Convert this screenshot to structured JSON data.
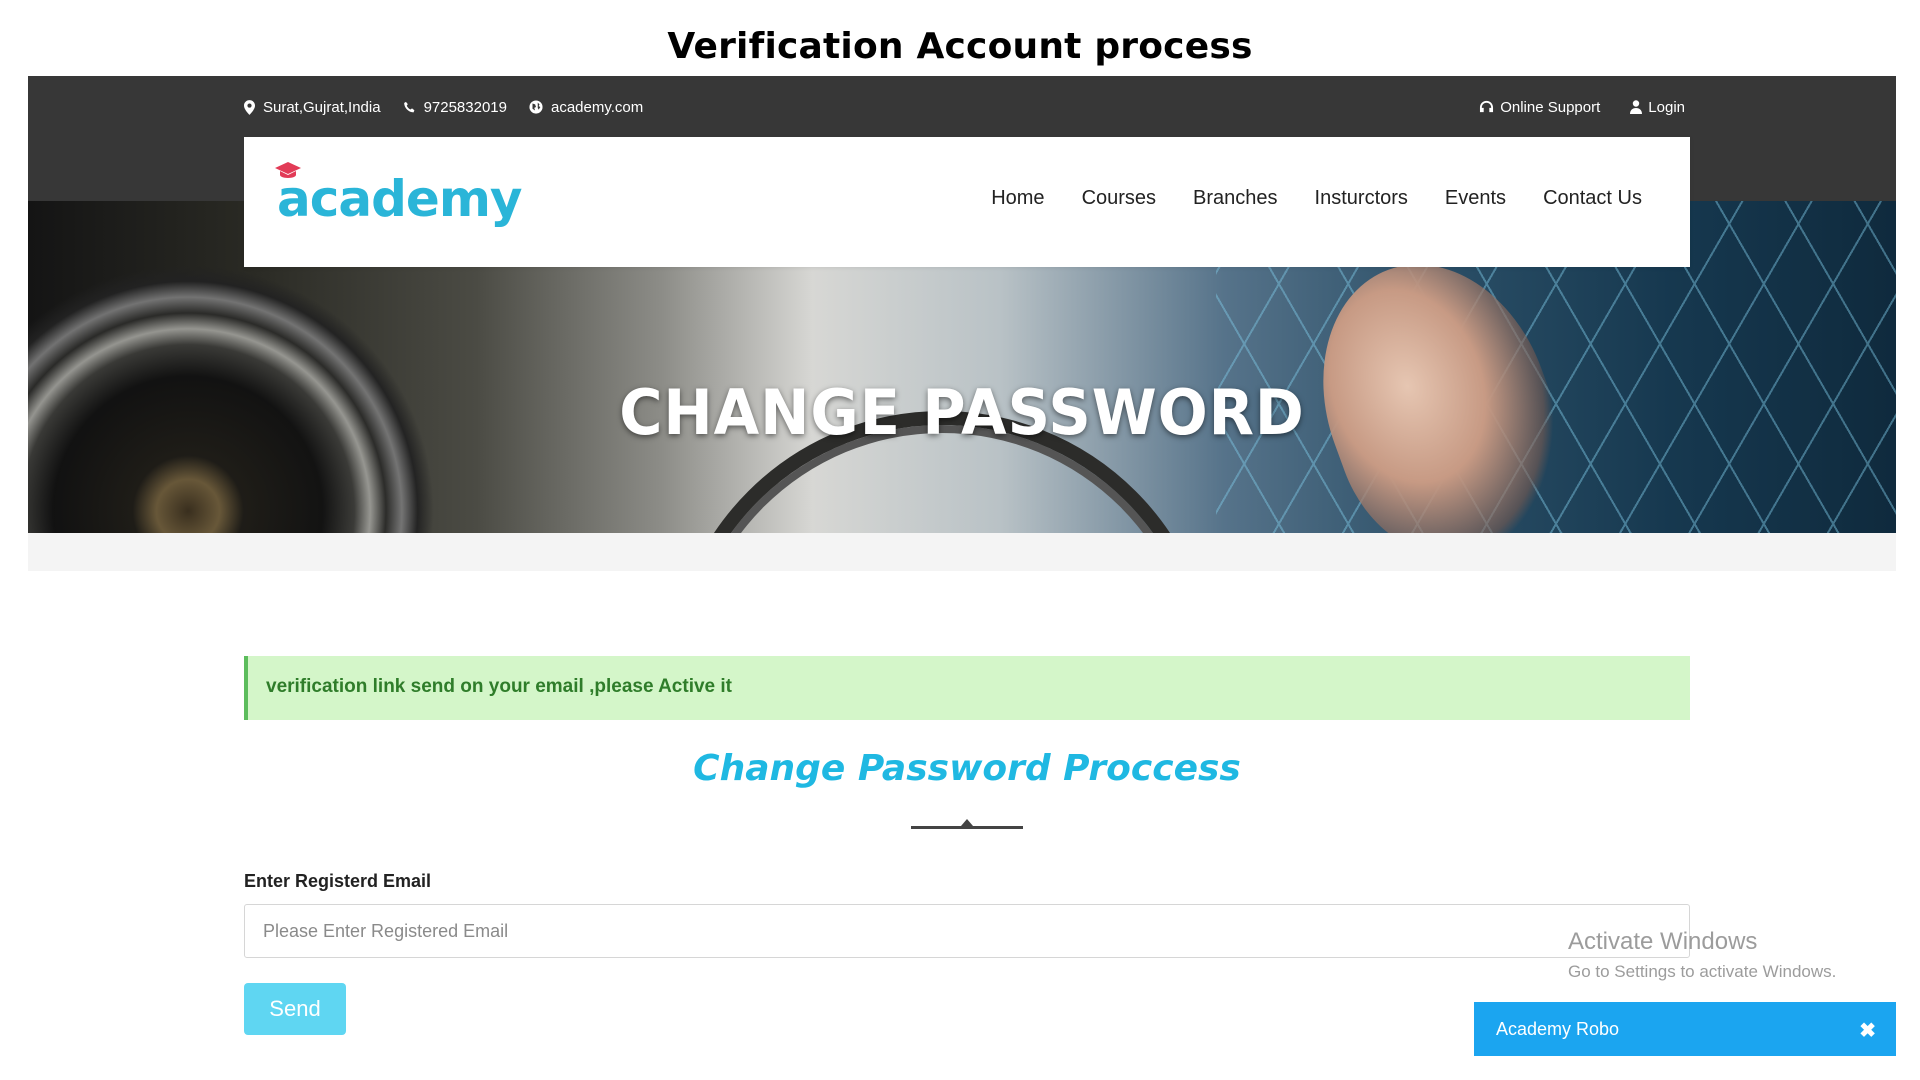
{
  "caption": "Verification Account process",
  "topbar": {
    "location": "Surat,Gujrat,India",
    "phone": "9725832019",
    "website": "academy.com",
    "online_support": "Online Support",
    "login": "Login"
  },
  "brand": {
    "logo_text": "academy",
    "accent": "#2ab5d8",
    "dot_color": "#e23b57"
  },
  "nav": {
    "items": [
      "Home",
      "Courses",
      "Branches",
      "Insturctors",
      "Events",
      "Contact Us"
    ]
  },
  "hero": {
    "title": "CHANGE PASSWORD"
  },
  "alert": {
    "message": "verification link send on your email ,please Active it"
  },
  "form": {
    "title": "Change Password Proccess",
    "email_label": "Enter Registerd Email",
    "email_placeholder": "Please Enter Registered Email",
    "email_value": "",
    "send_label": "Send"
  },
  "watermark": {
    "line1": "Activate Windows",
    "line2": "Go to Settings to activate Windows."
  },
  "chat": {
    "title": "Academy Robo",
    "close_symbol": "✖"
  }
}
